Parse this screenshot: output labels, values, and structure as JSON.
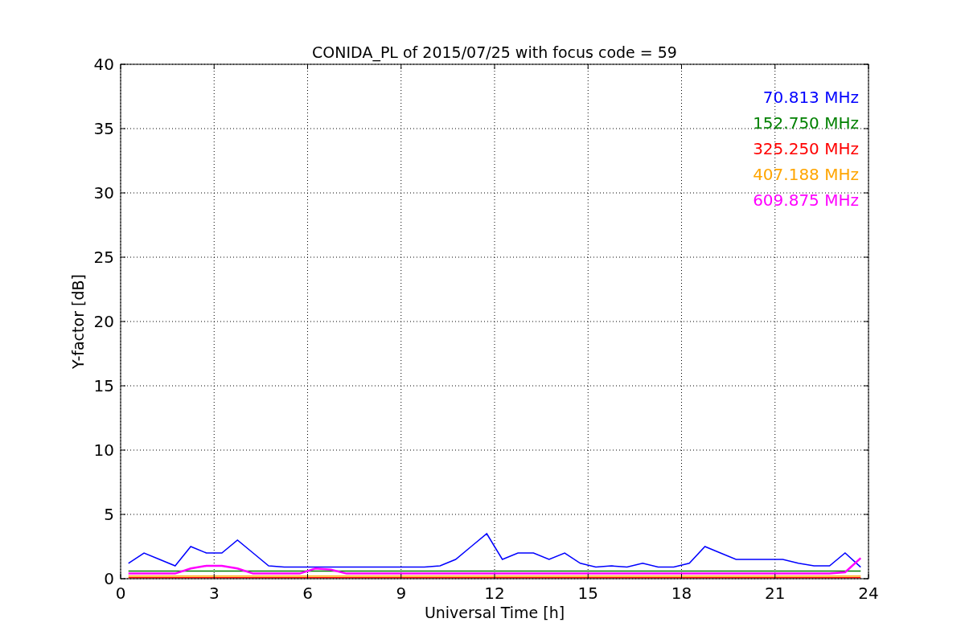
{
  "chart_data": {
    "type": "line",
    "title": "CONIDA_PL of 2015/07/25 with focus code = 59",
    "xlabel": "Universal Time [h]",
    "ylabel": "Y-factor [dB]",
    "x": [
      0.25,
      0.75,
      1.25,
      1.75,
      2.25,
      2.75,
      3.25,
      3.75,
      4.25,
      4.75,
      5.25,
      5.75,
      6.25,
      6.75,
      7.25,
      7.75,
      8.25,
      8.75,
      9.25,
      9.75,
      10.25,
      10.75,
      11.25,
      11.75,
      12.25,
      12.75,
      13.25,
      13.75,
      14.25,
      14.75,
      15.25,
      15.75,
      16.25,
      16.75,
      17.25,
      17.75,
      18.25,
      18.75,
      19.25,
      19.75,
      20.25,
      20.75,
      21.25,
      21.75,
      22.25,
      22.75,
      23.25,
      23.75
    ],
    "series": [
      {
        "name": "70.813 MHz",
        "color": "#0000ff",
        "values": [
          1.2,
          2.0,
          1.5,
          1.0,
          2.5,
          2.0,
          2.0,
          3.0,
          2.0,
          1.0,
          0.9,
          0.9,
          0.9,
          0.9,
          0.9,
          0.9,
          0.9,
          0.9,
          0.9,
          0.9,
          1.0,
          1.5,
          2.5,
          3.5,
          1.5,
          2.0,
          2.0,
          1.5,
          2.0,
          1.2,
          0.9,
          1.0,
          0.9,
          1.2,
          0.9,
          0.9,
          1.2,
          2.5,
          2.0,
          1.5,
          1.5,
          1.5,
          1.5,
          1.2,
          1.0,
          1.0,
          2.0,
          0.9
        ]
      },
      {
        "name": "152.750 MHz",
        "color": "#008000",
        "values": [
          0.6,
          0.6,
          0.6,
          0.6,
          0.6,
          0.6,
          0.6,
          0.6,
          0.6,
          0.6,
          0.6,
          0.6,
          0.6,
          0.6,
          0.6,
          0.6,
          0.6,
          0.6,
          0.6,
          0.6,
          0.6,
          0.6,
          0.6,
          0.6,
          0.6,
          0.6,
          0.6,
          0.6,
          0.6,
          0.6,
          0.6,
          0.6,
          0.6,
          0.6,
          0.6,
          0.6,
          0.6,
          0.6,
          0.6,
          0.6,
          0.6,
          0.6,
          0.6,
          0.6,
          0.6,
          0.6,
          0.6,
          0.6
        ]
      },
      {
        "name": "325.250 MHz",
        "color": "#ff0000",
        "values": [
          0.08,
          0.08,
          0.08,
          0.08,
          0.08,
          0.08,
          0.08,
          0.08,
          0.08,
          0.08,
          0.08,
          0.08,
          0.08,
          0.08,
          0.08,
          0.08,
          0.08,
          0.08,
          0.08,
          0.08,
          0.08,
          0.08,
          0.08,
          0.08,
          0.08,
          0.08,
          0.08,
          0.08,
          0.08,
          0.08,
          0.08,
          0.08,
          0.08,
          0.08,
          0.08,
          0.08,
          0.08,
          0.08,
          0.08,
          0.08,
          0.08,
          0.08,
          0.08,
          0.08,
          0.08,
          0.08,
          0.08,
          0.08
        ]
      },
      {
        "name": "407.188 MHz",
        "color": "#ffa500",
        "values": [
          0.2,
          0.2,
          0.2,
          0.2,
          0.2,
          0.2,
          0.2,
          0.2,
          0.2,
          0.2,
          0.2,
          0.2,
          0.2,
          0.2,
          0.2,
          0.2,
          0.2,
          0.2,
          0.2,
          0.2,
          0.2,
          0.2,
          0.2,
          0.2,
          0.2,
          0.2,
          0.2,
          0.2,
          0.2,
          0.2,
          0.2,
          0.2,
          0.2,
          0.2,
          0.2,
          0.2,
          0.2,
          0.2,
          0.2,
          0.2,
          0.2,
          0.2,
          0.2,
          0.2,
          0.2,
          0.2,
          0.2,
          0.2
        ]
      },
      {
        "name": "609.875 MHz",
        "color": "#ff00ff",
        "values": [
          0.4,
          0.4,
          0.4,
          0.4,
          0.8,
          1.0,
          1.0,
          0.8,
          0.4,
          0.4,
          0.4,
          0.4,
          0.8,
          0.7,
          0.4,
          0.4,
          0.4,
          0.4,
          0.4,
          0.4,
          0.4,
          0.4,
          0.4,
          0.4,
          0.4,
          0.4,
          0.4,
          0.4,
          0.4,
          0.4,
          0.4,
          0.4,
          0.4,
          0.4,
          0.4,
          0.4,
          0.4,
          0.4,
          0.4,
          0.4,
          0.4,
          0.4,
          0.4,
          0.4,
          0.4,
          0.4,
          0.5,
          1.6
        ]
      }
    ],
    "xlim": [
      0,
      24
    ],
    "ylim": [
      0,
      40
    ],
    "xticks": [
      0,
      3,
      6,
      9,
      12,
      15,
      18,
      21,
      24
    ],
    "yticks": [
      0,
      5,
      10,
      15,
      20,
      25,
      30,
      35,
      40
    ],
    "grid": true
  }
}
